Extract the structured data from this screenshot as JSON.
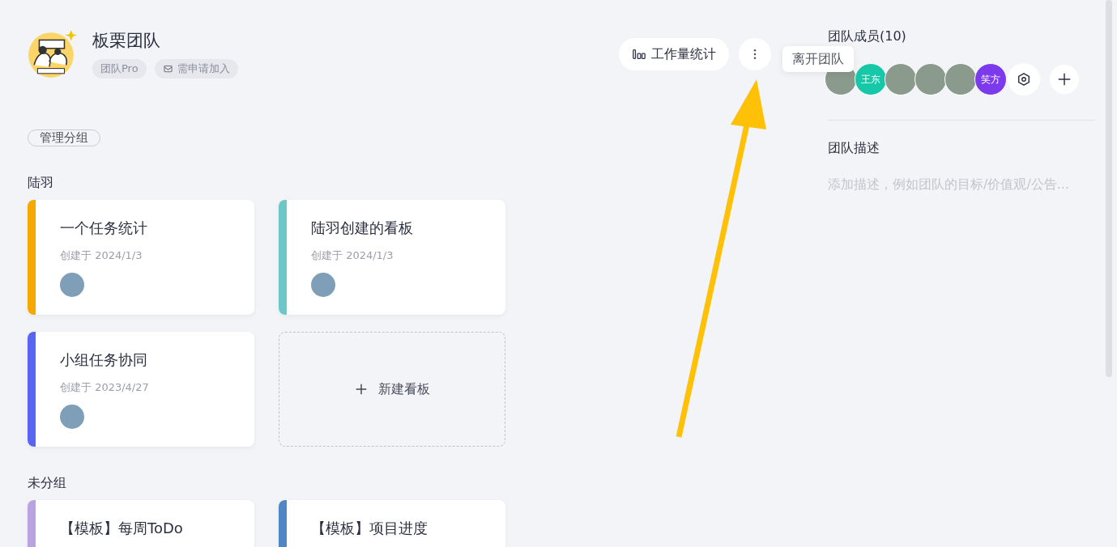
{
  "team": {
    "name": "板栗团队",
    "tags": [
      {
        "kind": "plan",
        "label": "团队Pro"
      },
      {
        "kind": "join",
        "label": "需申请加入"
      }
    ]
  },
  "actions": {
    "workload_button": "工作量统计",
    "tooltip": "离开团队"
  },
  "manage_groups_button": "管理分组",
  "groups": [
    {
      "title": "陆羽",
      "boards": [
        {
          "title": "一个任务统计",
          "date": "创建于 2024/1/3",
          "color": "#f5a800"
        },
        {
          "title": "陆羽创建的看板",
          "date": "创建于 2024/1/3",
          "color": "#6cc8c8"
        },
        {
          "title": "小组任务协同",
          "date": "创建于 2023/4/27",
          "color": "#5865f2"
        }
      ],
      "new_board": "新建看板"
    },
    {
      "title": "未分组",
      "boards": [
        {
          "title": "【模板】每周ToDo",
          "color": "#b9a3e0"
        },
        {
          "title": "【模板】项目进度",
          "color": "#4f86c6"
        }
      ]
    }
  ],
  "sidebar": {
    "members_title": "团队成员(10)",
    "members": [
      {
        "kind": "photo"
      },
      {
        "kind": "text",
        "label": "王东",
        "color": "#16c7a8"
      },
      {
        "kind": "photo"
      },
      {
        "kind": "photo"
      },
      {
        "kind": "photo"
      },
      {
        "kind": "text",
        "label": "笑方",
        "color": "#7c3aed"
      }
    ],
    "description_title": "团队描述",
    "description_placeholder": "添加描述，例如团队的目标/价值观/公告..."
  }
}
